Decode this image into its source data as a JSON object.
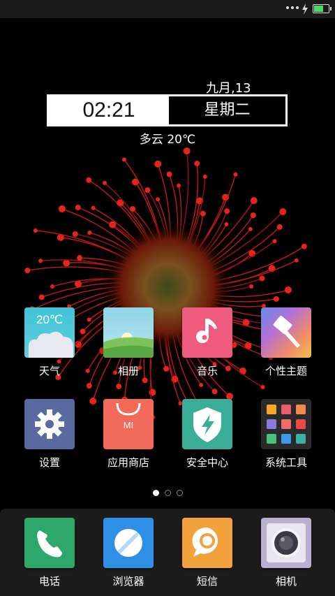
{
  "status_bar": {
    "battery_percent": 70,
    "battery_color": "#4cd964"
  },
  "clock_widget": {
    "date": "九月,13",
    "time": "02:21",
    "weekday": "星期二",
    "weather": "多云  20℃"
  },
  "apps": [
    {
      "label": "天气",
      "icon": "weather-icon",
      "icon_text": "20℃"
    },
    {
      "label": "相册",
      "icon": "gallery-icon"
    },
    {
      "label": "音乐",
      "icon": "music-icon"
    },
    {
      "label": "个性主题",
      "icon": "themes-icon"
    },
    {
      "label": "设置",
      "icon": "gear-icon"
    },
    {
      "label": "应用商店",
      "icon": "app-store-icon",
      "icon_text": "MI"
    },
    {
      "label": "安全中心",
      "icon": "security-shield-icon"
    },
    {
      "label": "系统工具",
      "icon": "tools-folder-icon"
    }
  ],
  "page_indicator": {
    "count": 3,
    "active": 0
  },
  "dock": [
    {
      "label": "电话",
      "icon": "phone-icon"
    },
    {
      "label": "浏览器",
      "icon": "browser-icon"
    },
    {
      "label": "短信",
      "icon": "sms-icon"
    },
    {
      "label": "相机",
      "icon": "camera-icon"
    }
  ]
}
